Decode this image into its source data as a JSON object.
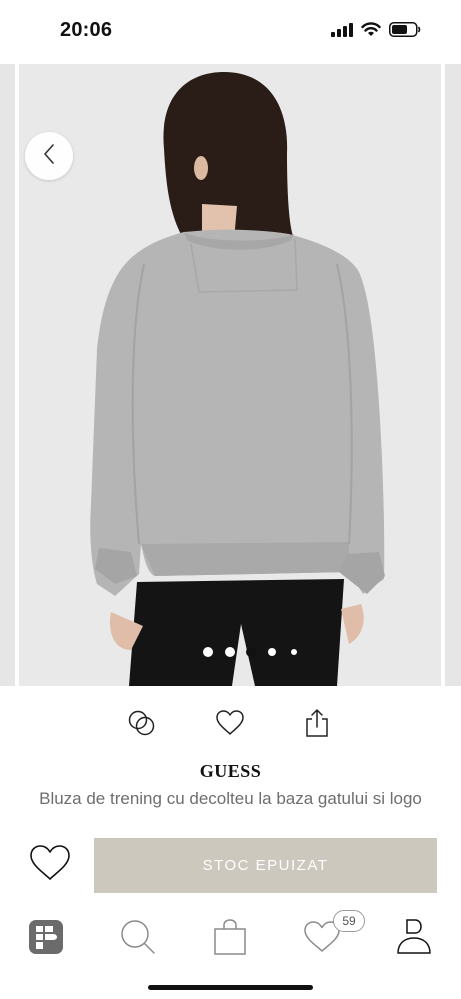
{
  "status_bar": {
    "time": "20:06",
    "icons": [
      "signal-icon",
      "wifi-icon",
      "battery-icon"
    ]
  },
  "gallery": {
    "image_count": 5,
    "active_index": 2,
    "image_description": "model wearing grey sweatshirt, back view"
  },
  "actions": {
    "icons": [
      "compare-icon",
      "heart-icon",
      "share-icon"
    ]
  },
  "product": {
    "brand": "GUESS",
    "title": "Bluza de trening cu decolteu la baza gatului si logo",
    "stock_button_label": "STOC EPUIZAT"
  },
  "tabbar": {
    "items": [
      "home-logo-icon",
      "search-icon",
      "bag-icon",
      "wishlist-icon",
      "account-icon"
    ],
    "wishlist_count": "59"
  },
  "colors": {
    "stock_button": "#cdc8be",
    "background": "#ffffff",
    "product_bg": "#e9e9e9",
    "title_text": "#6e6e6e"
  }
}
